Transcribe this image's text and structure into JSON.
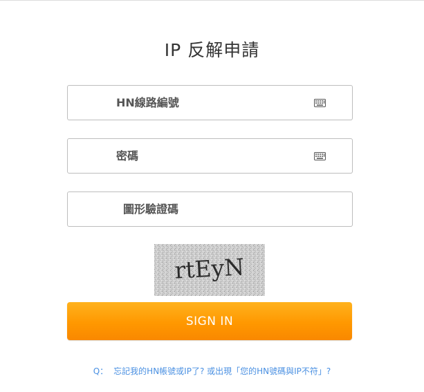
{
  "page": {
    "title": "IP 反解申請"
  },
  "form": {
    "hn_number": {
      "placeholder": "HN線路編號",
      "value": "",
      "icon": "keyboard-icon"
    },
    "password": {
      "placeholder": "密碼",
      "value": "",
      "icon": "keyboard-icon"
    },
    "captcha_input": {
      "placeholder": "圖形驗證碼",
      "value": ""
    },
    "captcha_image_text": "rtEyN",
    "signin_label": "SIGN IN"
  },
  "help": {
    "prefix": "Q：",
    "text": "忘記我的HN帳號或IP了? 或出現「您的HN號碼與IP不符」?"
  },
  "colors": {
    "accent": "#ff9800",
    "link": "#4a90e2",
    "border": "#bdbdbd"
  }
}
